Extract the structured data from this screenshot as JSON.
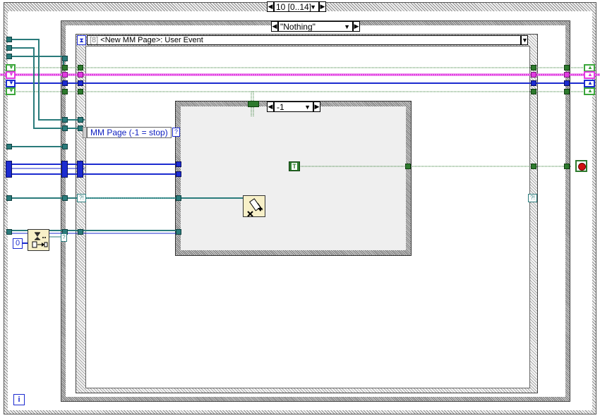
{
  "outer_sequence": {
    "frame_selector": "10 [0..14]"
  },
  "case_structure": {
    "selector_value": "\"Nothing\""
  },
  "event_structure": {
    "selector_index": "[8]",
    "selector_event": "<New MM Page>: User Event"
  },
  "inner_case": {
    "selector_value": "-1"
  },
  "terminals": {
    "mm_page_label": "MM Page (-1 = stop)",
    "mm_page_question": "?",
    "numeric_constant": "0",
    "true_constant": "T",
    "info_icon_text": "i",
    "shift_dot_left": "?",
    "event_data_left": "?!",
    "event_data_right": "?!"
  },
  "colors": {
    "boolean_wire": "#2d7a2d",
    "refnum_wire": "#2a7b7b",
    "cluster_wire": "#e23ae2",
    "integer_wire": "#1c2bd0",
    "stop_terminal": "#d01010"
  }
}
